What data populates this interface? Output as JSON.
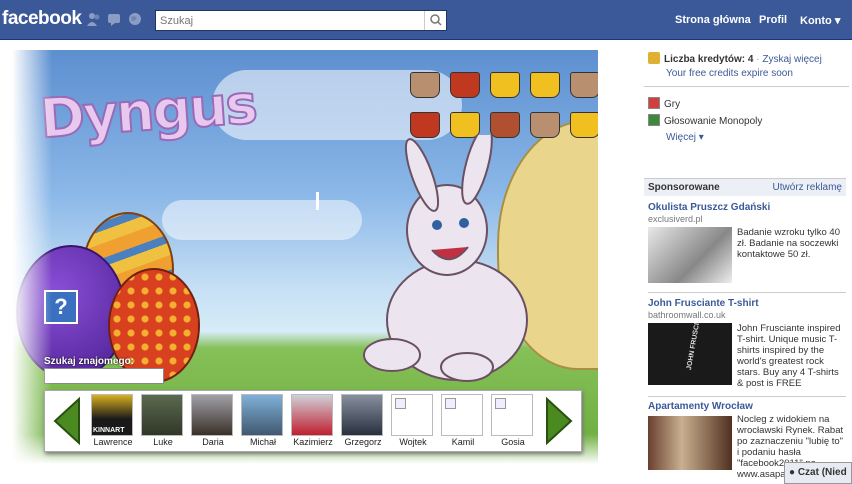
{
  "topbar": {
    "logo": "facebook",
    "search_placeholder": "Szukaj",
    "nav": [
      "Strona główna",
      "Profil",
      "Konto ▾"
    ]
  },
  "game": {
    "title": "Dyngus",
    "help_label": "?",
    "find_friend_label": "Szukaj znajomego:",
    "friends": [
      {
        "name": "Lawrence",
        "photo_label": "KINNART"
      },
      {
        "name": "Luke"
      },
      {
        "name": "Daria"
      },
      {
        "name": "Michał"
      },
      {
        "name": "Kazimierz"
      },
      {
        "name": "Grzegorz"
      },
      {
        "name": "Wojtek"
      },
      {
        "name": "Kamil"
      },
      {
        "name": "Gosia"
      }
    ]
  },
  "sidebar": {
    "credits_label": "Liczba kredytów: 4",
    "credits_link": "Zyskaj więcej",
    "credits_expire": "Your free credits expire soon",
    "apps": [
      "Gry",
      "Głosowanie Monopoly"
    ],
    "more": "Więcej",
    "sponsored": "Sponsorowane",
    "create_ad": "Utwórz reklamę",
    "ads": [
      {
        "title": "Okulista Pruszcz Gdański",
        "url": "exclusiverd.pl",
        "text": "Badanie wzroku tylko 40 zł. Badanie na soczewki kontaktowe 50 zł."
      },
      {
        "title": "John Frusciante T-shirt",
        "url": "bathroomwall.co.uk",
        "text": "John Frusciante inspired T-shirt. Unique music T-shirts inspired by the world's greatest rock stars. Buy any 4 T-shirts & post is FREE",
        "img_text": "JOHN FRUSCIANTE"
      },
      {
        "title": "Apartamenty Wrocław",
        "url": "",
        "text": "Nocleg z widokiem na wrocławski Rynek. Rabat po zaznaczeniu \"lubię to\" i podaniu hasła \"facebook2011\" na www.asapa..."
      }
    ],
    "chat": "Czat (Nied"
  }
}
